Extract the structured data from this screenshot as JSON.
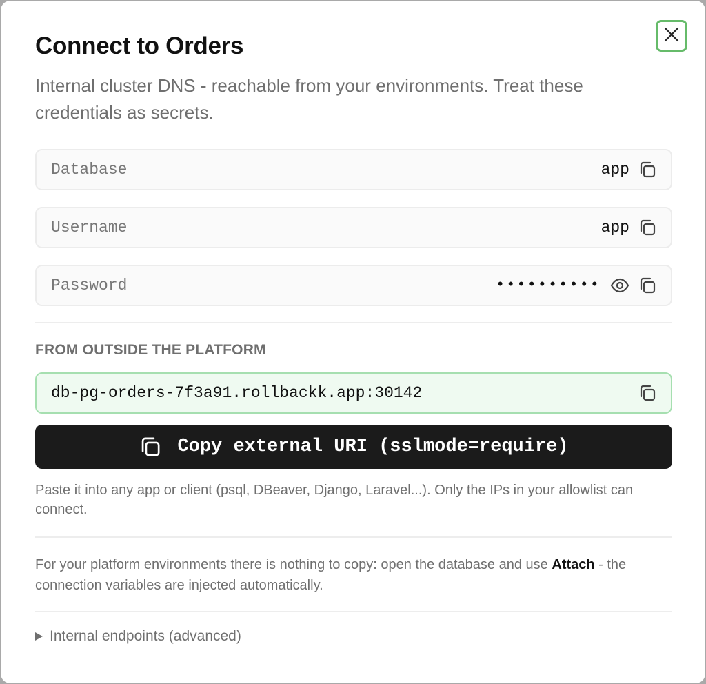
{
  "dialog": {
    "title": "Connect to Orders",
    "subtitle": "Internal cluster DNS - reachable from your environments. Treat these credentials as secrets."
  },
  "credentials": [
    {
      "label": "Database",
      "value": "app"
    },
    {
      "label": "Username",
      "value": "app"
    },
    {
      "label": "Password",
      "value": "••••••••••"
    }
  ],
  "external": {
    "heading": "FROM OUTSIDE THE PLATFORM",
    "host": "db-pg-orders-7f3a91.rollbackk.app:30142",
    "copy_button_label": "Copy external URI (sslmode=require)",
    "hint": "Paste it into any app or client (psql, DBeaver, Django, Laravel...). Only the IPs in your allowlist can connect."
  },
  "note": {
    "prefix": "For your platform environments there is nothing to copy: open the database and use ",
    "emphasis": "Attach",
    "suffix": " - the connection variables are injected automatically."
  },
  "advanced": {
    "label": "Internal endpoints (advanced)"
  },
  "icons": {
    "close": "close-icon",
    "copy": "copy-icon",
    "reveal": "eye-icon",
    "disclosure": "triangle-right-icon"
  },
  "colors": {
    "primary_button": "#1b1b1b",
    "external_field_bg": "#effaf1",
    "external_field_border": "#a6dfb0",
    "focus_ring": "#66bb6a"
  }
}
